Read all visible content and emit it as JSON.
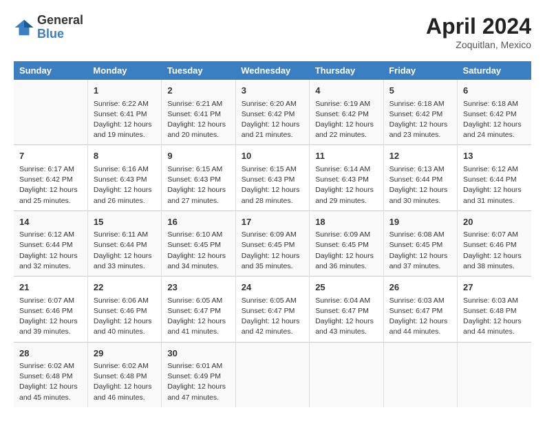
{
  "logo": {
    "line1": "General",
    "line2": "Blue"
  },
  "title": "April 2024",
  "subtitle": "Zoquitlan, Mexico",
  "days_of_week": [
    "Sunday",
    "Monday",
    "Tuesday",
    "Wednesday",
    "Thursday",
    "Friday",
    "Saturday"
  ],
  "weeks": [
    [
      {
        "num": "",
        "sunrise": "",
        "sunset": "",
        "daylight": ""
      },
      {
        "num": "1",
        "sunrise": "Sunrise: 6:22 AM",
        "sunset": "Sunset: 6:41 PM",
        "daylight": "Daylight: 12 hours and 19 minutes."
      },
      {
        "num": "2",
        "sunrise": "Sunrise: 6:21 AM",
        "sunset": "Sunset: 6:41 PM",
        "daylight": "Daylight: 12 hours and 20 minutes."
      },
      {
        "num": "3",
        "sunrise": "Sunrise: 6:20 AM",
        "sunset": "Sunset: 6:42 PM",
        "daylight": "Daylight: 12 hours and 21 minutes."
      },
      {
        "num": "4",
        "sunrise": "Sunrise: 6:19 AM",
        "sunset": "Sunset: 6:42 PM",
        "daylight": "Daylight: 12 hours and 22 minutes."
      },
      {
        "num": "5",
        "sunrise": "Sunrise: 6:18 AM",
        "sunset": "Sunset: 6:42 PM",
        "daylight": "Daylight: 12 hours and 23 minutes."
      },
      {
        "num": "6",
        "sunrise": "Sunrise: 6:18 AM",
        "sunset": "Sunset: 6:42 PM",
        "daylight": "Daylight: 12 hours and 24 minutes."
      }
    ],
    [
      {
        "num": "7",
        "sunrise": "Sunrise: 6:17 AM",
        "sunset": "Sunset: 6:42 PM",
        "daylight": "Daylight: 12 hours and 25 minutes."
      },
      {
        "num": "8",
        "sunrise": "Sunrise: 6:16 AM",
        "sunset": "Sunset: 6:43 PM",
        "daylight": "Daylight: 12 hours and 26 minutes."
      },
      {
        "num": "9",
        "sunrise": "Sunrise: 6:15 AM",
        "sunset": "Sunset: 6:43 PM",
        "daylight": "Daylight: 12 hours and 27 minutes."
      },
      {
        "num": "10",
        "sunrise": "Sunrise: 6:15 AM",
        "sunset": "Sunset: 6:43 PM",
        "daylight": "Daylight: 12 hours and 28 minutes."
      },
      {
        "num": "11",
        "sunrise": "Sunrise: 6:14 AM",
        "sunset": "Sunset: 6:43 PM",
        "daylight": "Daylight: 12 hours and 29 minutes."
      },
      {
        "num": "12",
        "sunrise": "Sunrise: 6:13 AM",
        "sunset": "Sunset: 6:44 PM",
        "daylight": "Daylight: 12 hours and 30 minutes."
      },
      {
        "num": "13",
        "sunrise": "Sunrise: 6:12 AM",
        "sunset": "Sunset: 6:44 PM",
        "daylight": "Daylight: 12 hours and 31 minutes."
      }
    ],
    [
      {
        "num": "14",
        "sunrise": "Sunrise: 6:12 AM",
        "sunset": "Sunset: 6:44 PM",
        "daylight": "Daylight: 12 hours and 32 minutes."
      },
      {
        "num": "15",
        "sunrise": "Sunrise: 6:11 AM",
        "sunset": "Sunset: 6:44 PM",
        "daylight": "Daylight: 12 hours and 33 minutes."
      },
      {
        "num": "16",
        "sunrise": "Sunrise: 6:10 AM",
        "sunset": "Sunset: 6:45 PM",
        "daylight": "Daylight: 12 hours and 34 minutes."
      },
      {
        "num": "17",
        "sunrise": "Sunrise: 6:09 AM",
        "sunset": "Sunset: 6:45 PM",
        "daylight": "Daylight: 12 hours and 35 minutes."
      },
      {
        "num": "18",
        "sunrise": "Sunrise: 6:09 AM",
        "sunset": "Sunset: 6:45 PM",
        "daylight": "Daylight: 12 hours and 36 minutes."
      },
      {
        "num": "19",
        "sunrise": "Sunrise: 6:08 AM",
        "sunset": "Sunset: 6:45 PM",
        "daylight": "Daylight: 12 hours and 37 minutes."
      },
      {
        "num": "20",
        "sunrise": "Sunrise: 6:07 AM",
        "sunset": "Sunset: 6:46 PM",
        "daylight": "Daylight: 12 hours and 38 minutes."
      }
    ],
    [
      {
        "num": "21",
        "sunrise": "Sunrise: 6:07 AM",
        "sunset": "Sunset: 6:46 PM",
        "daylight": "Daylight: 12 hours and 39 minutes."
      },
      {
        "num": "22",
        "sunrise": "Sunrise: 6:06 AM",
        "sunset": "Sunset: 6:46 PM",
        "daylight": "Daylight: 12 hours and 40 minutes."
      },
      {
        "num": "23",
        "sunrise": "Sunrise: 6:05 AM",
        "sunset": "Sunset: 6:47 PM",
        "daylight": "Daylight: 12 hours and 41 minutes."
      },
      {
        "num": "24",
        "sunrise": "Sunrise: 6:05 AM",
        "sunset": "Sunset: 6:47 PM",
        "daylight": "Daylight: 12 hours and 42 minutes."
      },
      {
        "num": "25",
        "sunrise": "Sunrise: 6:04 AM",
        "sunset": "Sunset: 6:47 PM",
        "daylight": "Daylight: 12 hours and 43 minutes."
      },
      {
        "num": "26",
        "sunrise": "Sunrise: 6:03 AM",
        "sunset": "Sunset: 6:47 PM",
        "daylight": "Daylight: 12 hours and 44 minutes."
      },
      {
        "num": "27",
        "sunrise": "Sunrise: 6:03 AM",
        "sunset": "Sunset: 6:48 PM",
        "daylight": "Daylight: 12 hours and 44 minutes."
      }
    ],
    [
      {
        "num": "28",
        "sunrise": "Sunrise: 6:02 AM",
        "sunset": "Sunset: 6:48 PM",
        "daylight": "Daylight: 12 hours and 45 minutes."
      },
      {
        "num": "29",
        "sunrise": "Sunrise: 6:02 AM",
        "sunset": "Sunset: 6:48 PM",
        "daylight": "Daylight: 12 hours and 46 minutes."
      },
      {
        "num": "30",
        "sunrise": "Sunrise: 6:01 AM",
        "sunset": "Sunset: 6:49 PM",
        "daylight": "Daylight: 12 hours and 47 minutes."
      },
      {
        "num": "",
        "sunrise": "",
        "sunset": "",
        "daylight": ""
      },
      {
        "num": "",
        "sunrise": "",
        "sunset": "",
        "daylight": ""
      },
      {
        "num": "",
        "sunrise": "",
        "sunset": "",
        "daylight": ""
      },
      {
        "num": "",
        "sunrise": "",
        "sunset": "",
        "daylight": ""
      }
    ]
  ]
}
